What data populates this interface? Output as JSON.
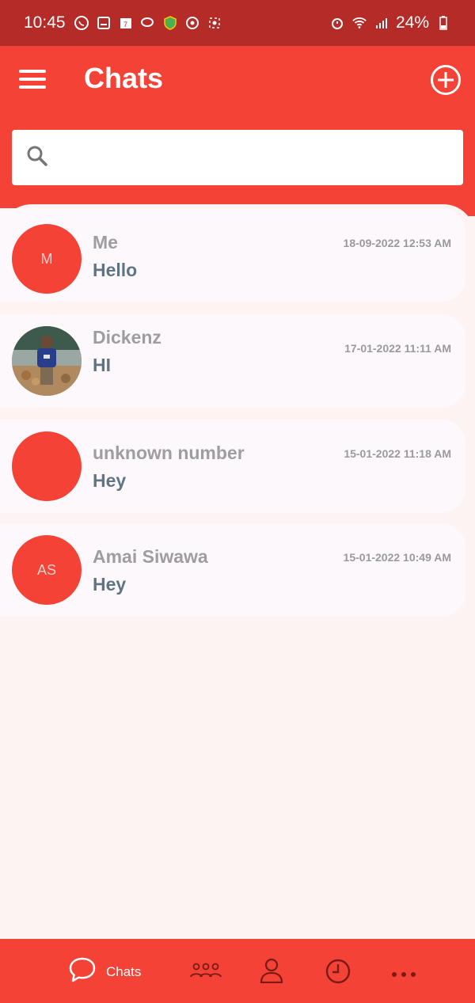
{
  "status_bar": {
    "time": "10:45",
    "battery": "24%"
  },
  "header": {
    "title": "Chats"
  },
  "search": {
    "placeholder": ""
  },
  "chats": [
    {
      "initials": "M",
      "name": "Me",
      "message": "Hello",
      "time": "18-09-2022 12:53 AM"
    },
    {
      "initials": "",
      "name": "Dickenz",
      "message": "HI",
      "time": "17-01-2022 11:11 AM"
    },
    {
      "initials": "",
      "name": "unknown number",
      "message": "Hey",
      "time": "15-01-2022 11:18 AM"
    },
    {
      "initials": "AS",
      "name": "Amai Siwawa",
      "message": "Hey",
      "time": "15-01-2022 10:49 AM"
    }
  ],
  "bottom_nav": {
    "chats_label": "Chats"
  },
  "colors": {
    "primary": "#f44336",
    "status_bar": "#b52b27",
    "name_gray": "#9e9e9e",
    "message_slate": "#5f7585"
  }
}
